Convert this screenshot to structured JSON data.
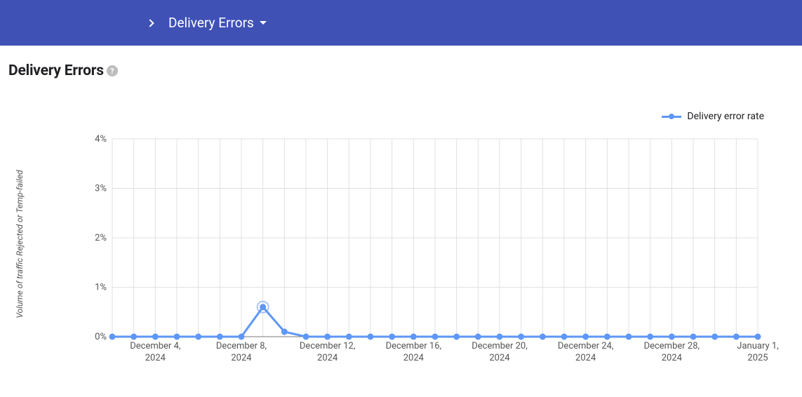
{
  "header": {
    "dropdown_label": "Delivery Errors"
  },
  "title": "Delivery Errors",
  "help_icon": "?",
  "legend": {
    "series_label": "Delivery error rate"
  },
  "ylabel": "Volume of traffic Rejected or Temp-failed",
  "chart_data": {
    "type": "line",
    "ylabel": "Volume of traffic Rejected or Temp-failed",
    "ylim": [
      0,
      4
    ],
    "y_ticks": [
      "0%",
      "1%",
      "2%",
      "3%",
      "4%"
    ],
    "x_tick_labels": [
      "December 4,\n2024",
      "December 8,\n2024",
      "December 12,\n2024",
      "December 16,\n2024",
      "December 20,\n2024",
      "December 24,\n2024",
      "December 28,\n2024",
      "January 1,\n2025"
    ],
    "series": [
      {
        "name": "Delivery error rate",
        "x_dates": [
          "2024-12-02",
          "2024-12-03",
          "2024-12-04",
          "2024-12-05",
          "2024-12-06",
          "2024-12-07",
          "2024-12-08",
          "2024-12-09",
          "2024-12-10",
          "2024-12-11",
          "2024-12-12",
          "2024-12-13",
          "2024-12-14",
          "2024-12-15",
          "2024-12-16",
          "2024-12-17",
          "2024-12-18",
          "2024-12-19",
          "2024-12-20",
          "2024-12-21",
          "2024-12-22",
          "2024-12-23",
          "2024-12-24",
          "2024-12-25",
          "2024-12-26",
          "2024-12-27",
          "2024-12-28",
          "2024-12-29",
          "2024-12-30",
          "2024-12-31",
          "2025-01-01"
        ],
        "values": [
          0,
          0,
          0,
          0,
          0,
          0,
          0,
          0.6,
          0.1,
          0,
          0,
          0,
          0,
          0,
          0,
          0,
          0,
          0,
          0,
          0,
          0,
          0,
          0,
          0,
          0,
          0,
          0,
          0,
          0,
          0,
          0
        ]
      }
    ],
    "highlight_index": 7
  }
}
